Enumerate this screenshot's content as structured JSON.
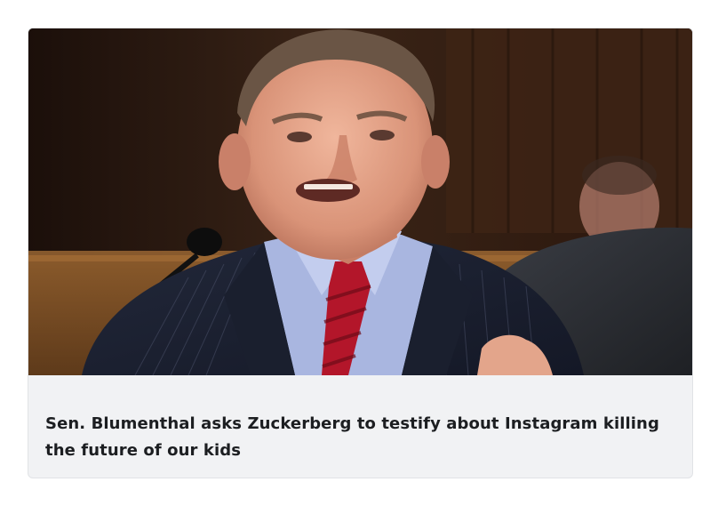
{
  "card": {
    "headline": "Sen. Blumenthal asks Zuckerberg to testify about Instagram killing the future of our kids",
    "image_description_icon": "photo-thumbnail"
  },
  "colors": {
    "card_background": "#f1f2f4",
    "headline_text": "#1c1e21",
    "page_background": "#ffffff"
  }
}
